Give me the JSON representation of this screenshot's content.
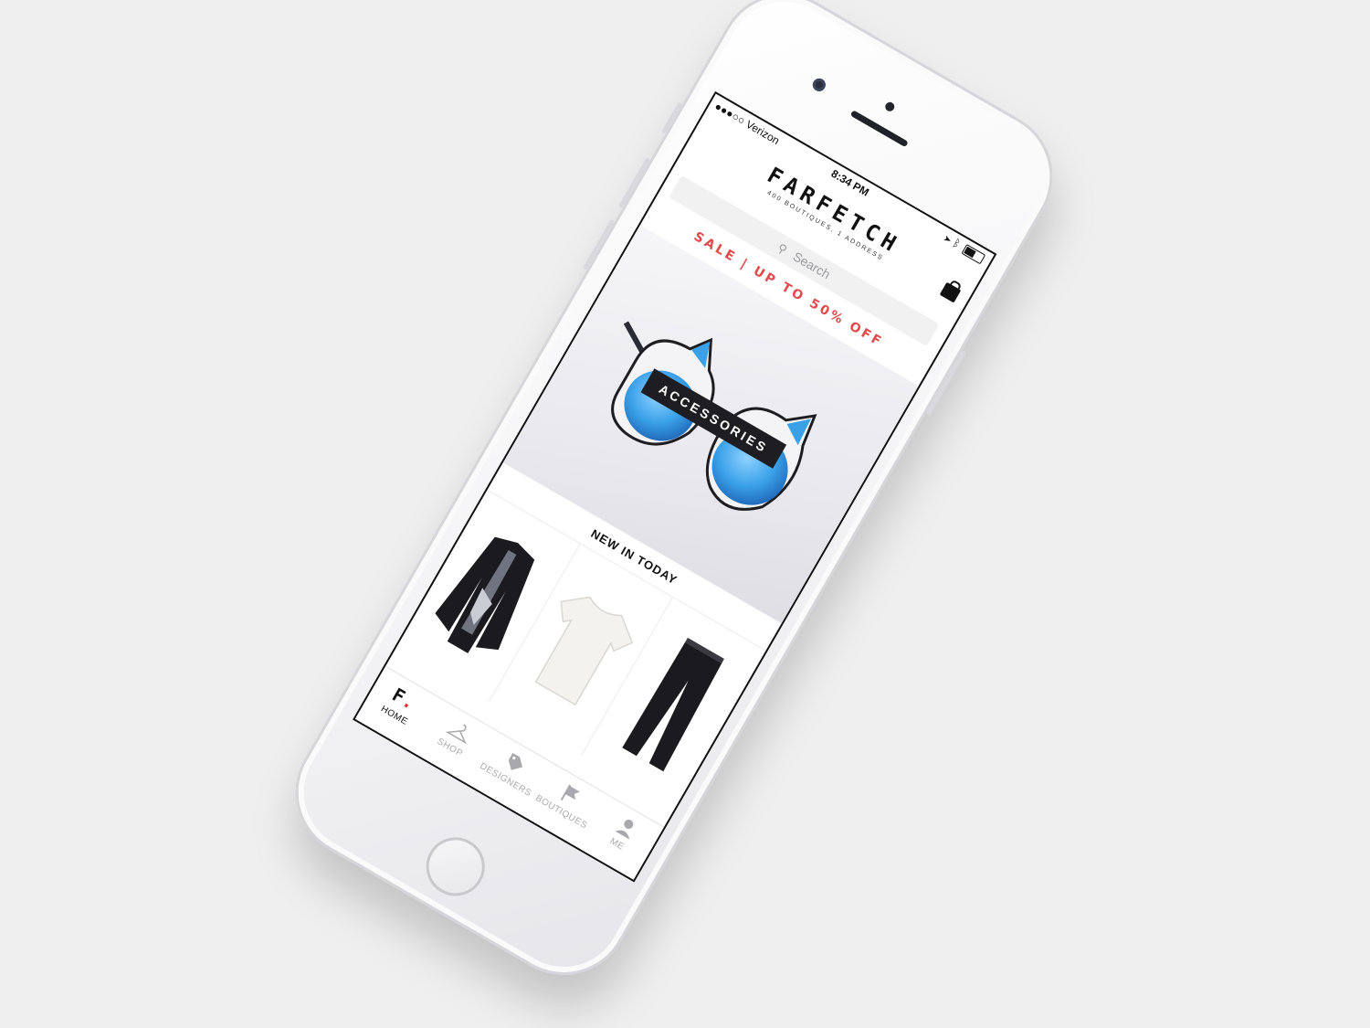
{
  "status_bar": {
    "carrier": "●●●○○ Verizon",
    "time": "8:34 PM",
    "battery_level": 0.55
  },
  "header": {
    "logo": "FARFETCH",
    "tagline": "400 BOUTIQUES, 1 ADDRESS",
    "bag_icon": "shopping-bag-icon"
  },
  "search": {
    "placeholder": "Search"
  },
  "promo": {
    "sale_text": "SALE | UP TO 50% OFF"
  },
  "hero": {
    "category": "ACCESSORIES"
  },
  "new_in": {
    "title": "NEW IN TODAY",
    "products": [
      {
        "kind": "black-jacket"
      },
      {
        "kind": "white-tee"
      },
      {
        "kind": "black-trousers"
      }
    ]
  },
  "tab_bar": {
    "items": [
      {
        "label": "HOME",
        "icon": "farfetch-f-icon",
        "active": true
      },
      {
        "label": "SHOP",
        "icon": "hanger-icon",
        "active": false
      },
      {
        "label": "DESIGNERS",
        "icon": "tag-icon",
        "active": false
      },
      {
        "label": "BOUTIQUES",
        "icon": "flag-icon",
        "active": false
      },
      {
        "label": "ME",
        "icon": "person-icon",
        "active": false
      }
    ]
  },
  "colors": {
    "accent": "#e04a4a",
    "lens": "#3aa0e8",
    "background": "#efeff0"
  }
}
